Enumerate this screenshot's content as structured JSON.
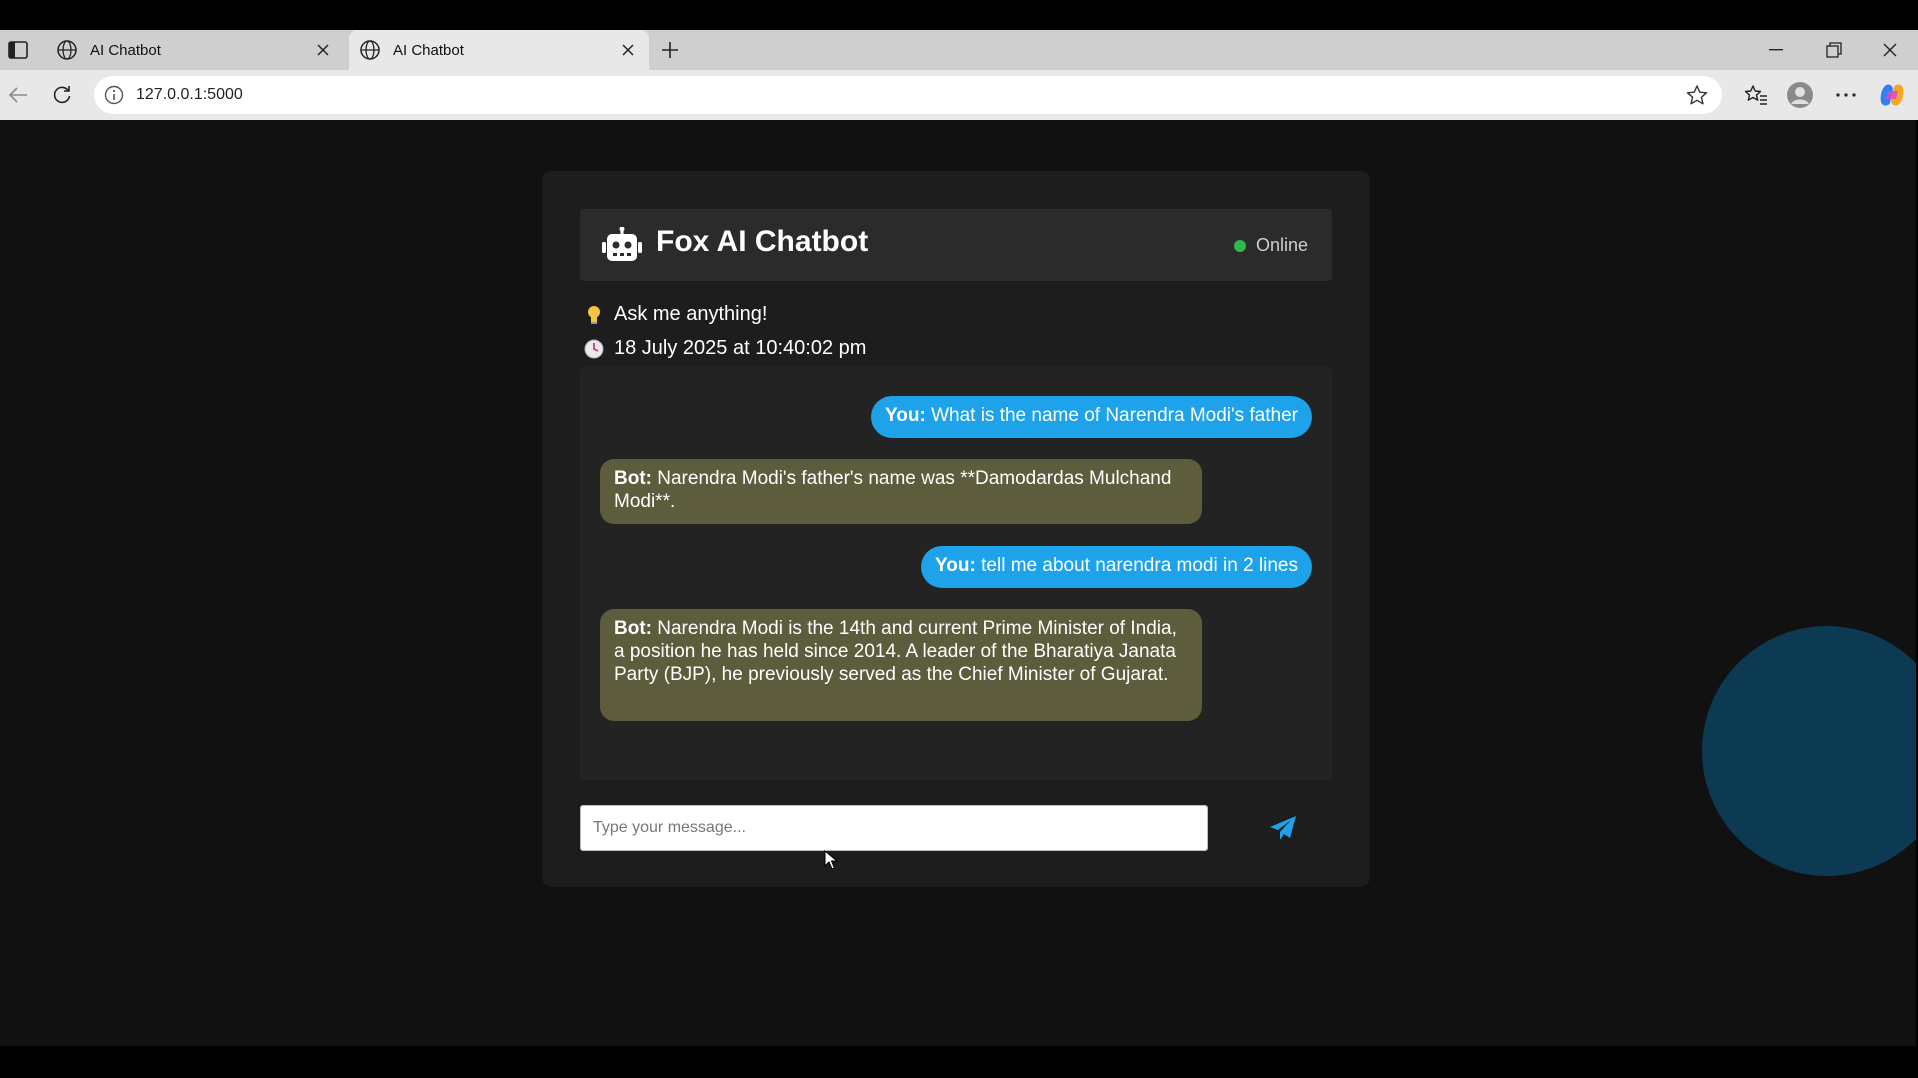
{
  "browser": {
    "tabs": [
      {
        "title": "AI Chatbot",
        "active": false
      },
      {
        "title": "AI Chatbot",
        "active": true
      }
    ],
    "url": "127.0.0.1:5000"
  },
  "app": {
    "title": "Fox AI Chatbot",
    "status": "Online",
    "status_color": "#2db84d",
    "tagline": "Ask me anything!",
    "timestamp": "18 July 2025 at 10:40:02 pm"
  },
  "messages": [
    {
      "role": "user",
      "speaker": "You:",
      "text": "What is the name of Narendra Modi's father"
    },
    {
      "role": "bot",
      "speaker": "Bot:",
      "text": "Narendra Modi's father's name was **Damodardas Mulchand Modi**."
    },
    {
      "role": "user",
      "speaker": "You:",
      "text": "tell me about narendra modi in 2 lines"
    },
    {
      "role": "bot",
      "speaker": "Bot:",
      "text": "Narendra Modi is the 14th and current Prime Minister of India, a position he has held since 2014. A leader of the Bharatiya Janata Party (BJP), he previously served as the Chief Minister of Gujarat."
    }
  ],
  "composer": {
    "placeholder": "Type your message..."
  },
  "colors": {
    "user_bubble": "#1ea2ea",
    "bot_bubble": "#5d5c3c",
    "send_icon": "#1ea2ea"
  }
}
